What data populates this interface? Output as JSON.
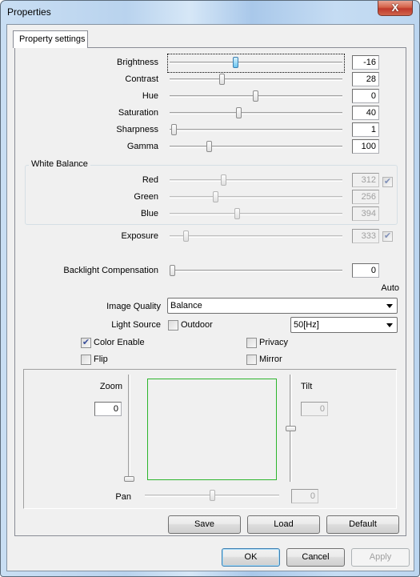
{
  "window": {
    "title": "Properties",
    "close_label": "X"
  },
  "tabs": [
    {
      "label": "Property settings",
      "active": true
    }
  ],
  "sliders": [
    {
      "id": "brightness",
      "label": "Brightness",
      "value": "-16",
      "position": 0.38,
      "focused": true
    },
    {
      "id": "contrast",
      "label": "Contrast",
      "value": "28",
      "position": 0.3
    },
    {
      "id": "hue",
      "label": "Hue",
      "value": "0",
      "position": 0.5
    },
    {
      "id": "saturation",
      "label": "Saturation",
      "value": "40",
      "position": 0.4
    },
    {
      "id": "sharpness",
      "label": "Sharpness",
      "value": "1",
      "position": 0.01
    },
    {
      "id": "gamma",
      "label": "Gamma",
      "value": "100",
      "position": 0.22
    }
  ],
  "white_balance": {
    "title": "White Balance",
    "auto_checked": true,
    "channels": [
      {
        "id": "red",
        "label": "Red",
        "value": "312",
        "position": 0.31
      },
      {
        "id": "green",
        "label": "Green",
        "value": "256",
        "position": 0.26
      },
      {
        "id": "blue",
        "label": "Blue",
        "value": "394",
        "position": 0.39
      }
    ]
  },
  "exposure": {
    "label": "Exposure",
    "value": "333",
    "position": 0.08,
    "auto_checked": true
  },
  "backlight": {
    "label": "Backlight Compensation",
    "value": "0",
    "position": 0.0
  },
  "auto_label": "Auto",
  "image_quality": {
    "label": "Image Quality",
    "selected": "Balance"
  },
  "light_source": {
    "label": "Light Source",
    "outdoor_label": "Outdoor",
    "outdoor_checked": false,
    "frequency": "50[Hz]"
  },
  "checkboxes": {
    "color_enable": {
      "label": "Color Enable",
      "checked": true
    },
    "flip": {
      "label": "Flip",
      "checked": false
    },
    "privacy": {
      "label": "Privacy",
      "checked": false
    },
    "mirror": {
      "label": "Mirror",
      "checked": false
    }
  },
  "ptz": {
    "zoom": {
      "label": "Zoom",
      "value": "0",
      "position": 0.0
    },
    "tilt": {
      "label": "Tilt",
      "value": "0",
      "position": 0.5
    },
    "pan": {
      "label": "Pan",
      "value": "0",
      "position": 0.5
    },
    "preview_color": "#2db52d"
  },
  "panel_buttons": {
    "save": "Save",
    "load": "Load",
    "default": "Default"
  },
  "dialog_buttons": {
    "ok": "OK",
    "cancel": "Cancel",
    "apply": "Apply"
  }
}
